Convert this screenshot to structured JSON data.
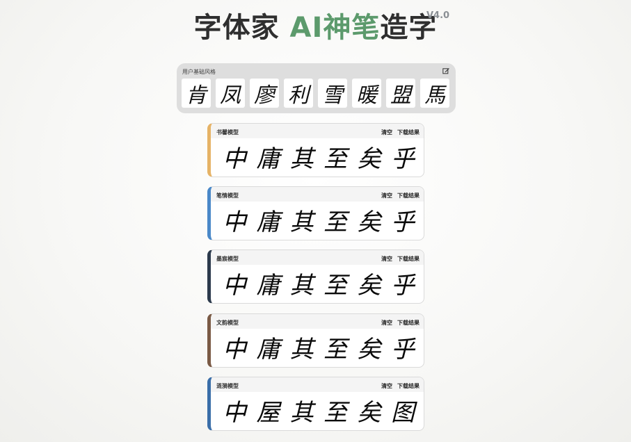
{
  "header": {
    "title_part1": "字体家 ",
    "title_accent": "AI神笔",
    "title_part2": "造字",
    "version": "V4.0",
    "accent_color": "#5c9a6c"
  },
  "base_style": {
    "label": "用户基础风格",
    "edit_icon": "edit-icon",
    "glyphs": [
      "肯",
      "凤",
      "廖",
      "利",
      "雪",
      "暖",
      "盟",
      "馬"
    ]
  },
  "models": [
    {
      "name": "书馨模型",
      "clear_label": "清空",
      "download_label": "下载结果",
      "accent_color": "#e6b366",
      "chars": [
        "中",
        "庸",
        "其",
        "至",
        "矣",
        "乎"
      ]
    },
    {
      "name": "笔情模型",
      "clear_label": "清空",
      "download_label": "下载结果",
      "accent_color": "#4a88c8",
      "chars": [
        "中",
        "庸",
        "其",
        "至",
        "矣",
        "乎"
      ]
    },
    {
      "name": "墨宸模型",
      "clear_label": "清空",
      "download_label": "下载结果",
      "accent_color": "#2c3a4c",
      "chars": [
        "中",
        "庸",
        "其",
        "至",
        "矣",
        "乎"
      ]
    },
    {
      "name": "文韵模型",
      "clear_label": "清空",
      "download_label": "下载结果",
      "accent_color": "#7a5a45",
      "chars": [
        "中",
        "庸",
        "其",
        "至",
        "矣",
        "乎"
      ]
    },
    {
      "name": "涟漪模型",
      "clear_label": "清空",
      "download_label": "下载结果",
      "accent_color": "#3a6ea8",
      "chars": [
        "中",
        "屋",
        "其",
        "至",
        "矣",
        "图"
      ]
    }
  ]
}
